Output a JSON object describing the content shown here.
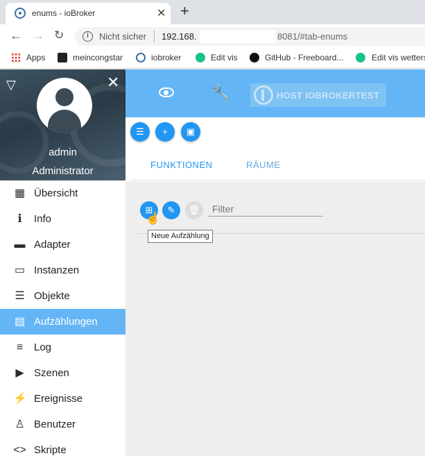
{
  "browser": {
    "tab_title": "enums - ioBroker",
    "tab_close": "✕",
    "new_tab": "+",
    "security_label": "Nicht sicher",
    "url_host": "192.168.",
    "url_port_path": "8081/#tab-enums",
    "bookmarks": [
      {
        "label": "Apps",
        "icon": "apps-grid-icon"
      },
      {
        "label": "meincongstar",
        "icon": "congstar-icon"
      },
      {
        "label": "iobroker",
        "icon": "iobroker-icon"
      },
      {
        "label": "Edit vis",
        "icon": "vis-icon"
      },
      {
        "label": "GitHub - Freeboard...",
        "icon": "github-icon"
      },
      {
        "label": "Edit vis wetters",
        "icon": "vis-icon"
      }
    ]
  },
  "sidebar": {
    "user_name": "admin",
    "user_role": "Administrator",
    "items": [
      {
        "label": "Übersicht",
        "icon": "apps-grid-icon",
        "glyph": "▦",
        "active": false
      },
      {
        "label": "Info",
        "icon": "info-icon",
        "glyph": "ℹ",
        "active": false
      },
      {
        "label": "Adapter",
        "icon": "store-icon",
        "glyph": "▬",
        "active": false
      },
      {
        "label": "Instanzen",
        "icon": "subtitles-icon",
        "glyph": "▭",
        "active": false
      },
      {
        "label": "Objekte",
        "icon": "list-icon",
        "glyph": "☰",
        "active": false
      },
      {
        "label": "Aufzählungen",
        "icon": "enum-card-icon",
        "glyph": "▤",
        "active": true
      },
      {
        "label": "Log",
        "icon": "log-lines-icon",
        "glyph": "≡",
        "active": false
      },
      {
        "label": "Szenen",
        "icon": "scenes-play-icon",
        "glyph": "▶",
        "active": false
      },
      {
        "label": "Ereignisse",
        "icon": "flash-icon",
        "glyph": "⚡",
        "active": false
      },
      {
        "label": "Benutzer",
        "icon": "person-icon",
        "glyph": "♙",
        "active": false
      },
      {
        "label": "Skripte",
        "icon": "code-icon",
        "glyph": "<>",
        "active": false
      }
    ]
  },
  "topbar": {
    "host_label": "HOST IOBROKERTEST"
  },
  "tabs": {
    "functions": "FUNKTIONEN",
    "rooms": "RÄUME"
  },
  "content": {
    "filter_placeholder": "Filter",
    "tooltip": "Neue Aufzählung"
  },
  "colors": {
    "accent": "#64b5f6",
    "button_blue": "#2196f3",
    "content_bg": "#eeeeee"
  }
}
